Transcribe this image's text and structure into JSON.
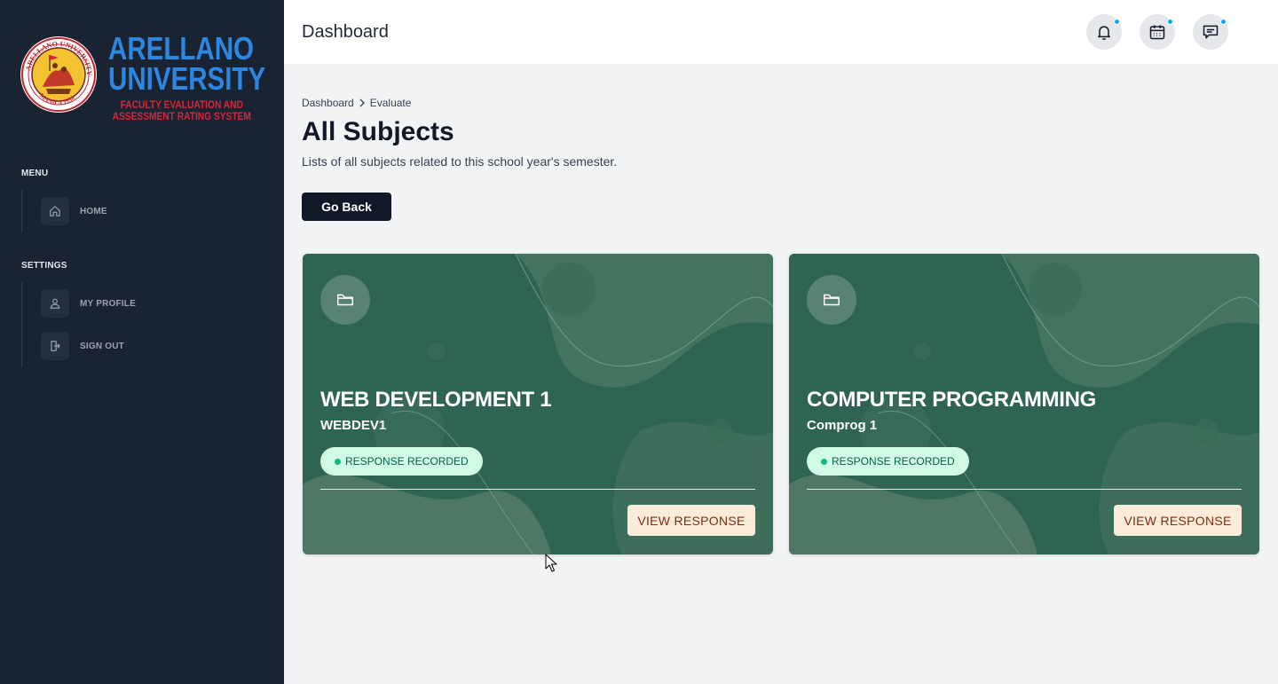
{
  "brand": {
    "name_line1": "ARELLANO",
    "name_line2": "UNIVERSITY",
    "subtitle_line1": "FACULTY EVALUATION AND",
    "subtitle_line2": "ASSESSMENT RATING SYSTEM",
    "seal_text_top": "ARELLANO UNIVERSITY",
    "seal_text_bottom": "MANILA 1938"
  },
  "sidebar": {
    "menu_title": "MENU",
    "menu_items": [
      {
        "label": "HOME",
        "icon": "home-icon"
      }
    ],
    "settings_title": "SETTINGS",
    "settings_items": [
      {
        "label": "MY PROFILE",
        "icon": "user-icon"
      },
      {
        "label": "SIGN OUT",
        "icon": "sign-out-icon"
      }
    ]
  },
  "header": {
    "title": "Dashboard",
    "icons": [
      "bell-icon",
      "calendar-icon",
      "chat-icon"
    ],
    "dot_color": "#0ea5e9"
  },
  "breadcrumb": {
    "items": [
      "Dashboard",
      "Evaluate"
    ]
  },
  "page": {
    "title": "All Subjects",
    "description": "Lists of all subjects related to this school year's semester.",
    "back_button": "Go Back"
  },
  "subjects": [
    {
      "title": "WEB DEVELOPMENT 1",
      "code": "WEBDEV1",
      "status": "RESPONSE RECORDED",
      "action": "VIEW RESPONSE"
    },
    {
      "title": "COMPUTER PROGRAMMING",
      "code": "Comprog 1",
      "status": "RESPONSE RECORDED",
      "action": "VIEW RESPONSE"
    }
  ],
  "colors": {
    "sidebar_bg": "#1a2332",
    "card_green": "#2f6452",
    "badge_bg": "#d1fae5",
    "action_bg": "#fdebd9",
    "brand_blue": "#2b87e0",
    "brand_red": "#d9253a"
  }
}
